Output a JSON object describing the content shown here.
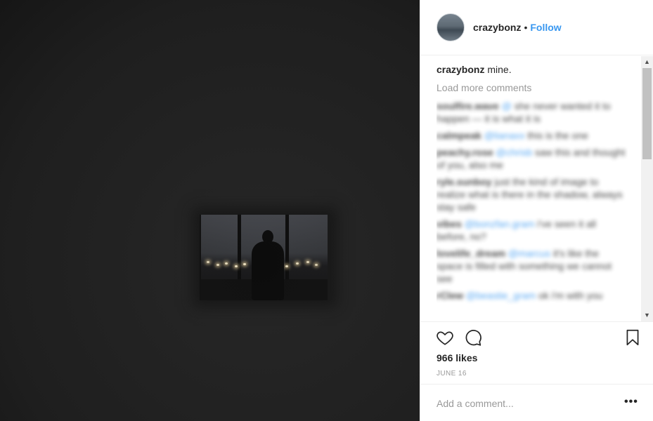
{
  "post": {
    "author": "crazybonz",
    "separator": "•",
    "follow_label": "Follow",
    "caption_text": " mine.",
    "load_more_label": "Load more comments",
    "blurred_comments": [
      {
        "user": "soulfire.wave",
        "tag": " @",
        "text": " she never wanted it to happen — it is what it is"
      },
      {
        "user": "calmpeak",
        "tag": " @lianaxx",
        "text": " this is the one"
      },
      {
        "user": "peachy.rose",
        "tag": " @chrisb",
        "text": " saw this and thought of you, also me"
      },
      {
        "user": "ryle.sunboy",
        "tag": "",
        "text": " just the kind of image to realize what is there in the shadow, always stay safe"
      },
      {
        "user": "vibes",
        "tag": " @bonzfan.gram",
        "text": " i've seen it all before, no?"
      },
      {
        "user": "lovelife_dream",
        "tag": " @marcus",
        "text": " it's like the space is filled with something we cannot see"
      },
      {
        "user": "rClew",
        "tag": " @beastie_gram",
        "text": " ok i'm with you"
      }
    ],
    "likes_text": "966 likes",
    "date_text": "JUNE 16",
    "comment_placeholder": "Add a comment...",
    "more_options": "•••"
  },
  "icons": {
    "like": "heart-icon",
    "comment": "speech-bubble-icon",
    "save": "bookmark-icon",
    "scroll_up": "▲",
    "scroll_down": "▼"
  },
  "colors": {
    "link_blue": "#3897f0",
    "muted_gray": "#999999",
    "photo_bg": "#272727"
  }
}
